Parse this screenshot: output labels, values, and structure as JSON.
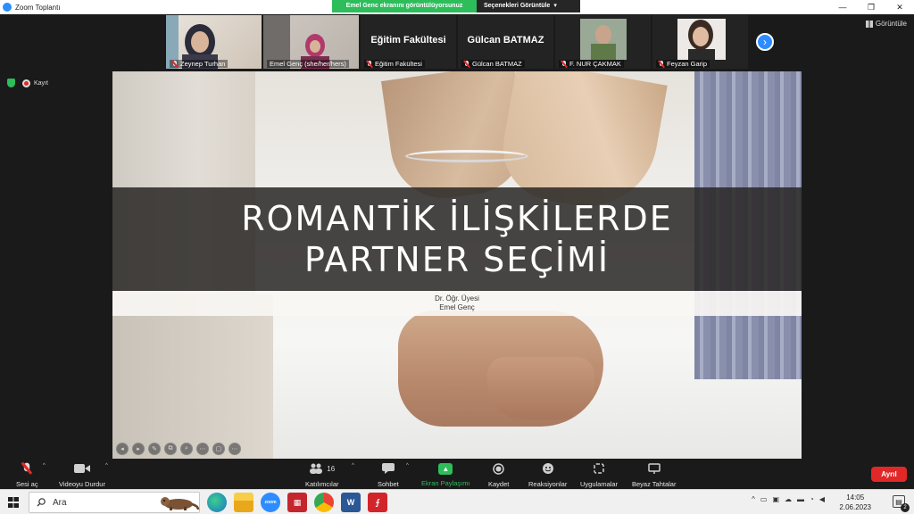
{
  "window": {
    "title": "Zoom Toplantı",
    "minimize": "—",
    "maximize": "❐",
    "close": "✕"
  },
  "share_banner": {
    "sharing_text": "Emel Genc ekranını görüntülüyorsunuz",
    "options_label": "Seçenekleri Görüntüle",
    "options_caret": "▾"
  },
  "participants": [
    {
      "name": "Zeynep Turhan",
      "muted": true,
      "has_video": true
    },
    {
      "name": "Emel Genç (she/her/hers)",
      "muted": false,
      "has_video": true
    },
    {
      "name": "Eğitim Fakültesi",
      "muted": true,
      "has_video": false
    },
    {
      "name": "Gülcan BATMAZ",
      "muted": true,
      "has_video": false
    },
    {
      "name": "F. NUR ÇAKMAK",
      "muted": true,
      "has_video": true
    },
    {
      "name": "Feyzan Garip",
      "muted": true,
      "has_video": true
    }
  ],
  "next_arrow": "›",
  "gallery_button": {
    "label": "Görüntüle"
  },
  "indicators": {
    "record_label": "Kayıt"
  },
  "slide": {
    "title_line1": "ROMANTİK İLİŞKİLERDE",
    "title_line2": "PARTNER SEÇİMİ",
    "subtitle_line1": "Dr. Öğr. Üyesi",
    "subtitle_line2": "Emel Genç"
  },
  "slide_controls": [
    "◂",
    "▸",
    "✎",
    "⧉",
    "⌕",
    "⋯",
    "▢",
    "⋯"
  ],
  "toolbar": {
    "mute_label": "Sesi aç",
    "video_label": "Videoyu Durdur",
    "participants_label": "Katılımcılar",
    "participants_count": "16",
    "chat_label": "Sohbet",
    "share_label": "Ekran Paylaşımı",
    "record_label": "Kaydet",
    "reactions_label": "Reaksiyonlar",
    "apps_label": "Uygulamalar",
    "whiteboard_label": "Beyaz Tahtalar",
    "leave_label": "Ayrıl",
    "caret": "^"
  },
  "taskbar": {
    "search_placeholder": "Ara",
    "time": "14:05",
    "date": "2.06.2023",
    "notification_count": "2",
    "tray_caret": "^"
  },
  "colors": {
    "zoom_blue": "#2d8cff",
    "share_green": "#2ebd5b",
    "leave_red": "#e02828",
    "meeting_bg": "#1a1a1a"
  }
}
